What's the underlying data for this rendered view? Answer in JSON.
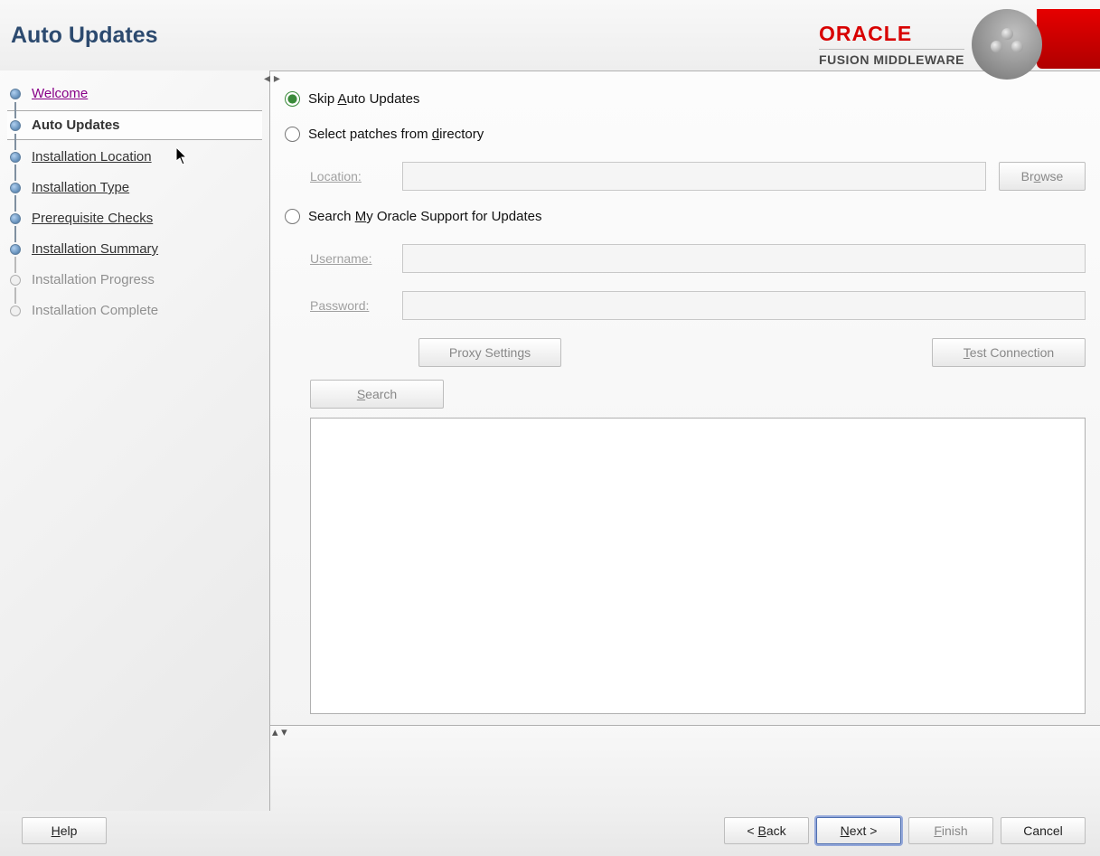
{
  "header": {
    "title": "Auto Updates",
    "brand_top": "ORACLE",
    "brand_bottom": "FUSION MIDDLEWARE"
  },
  "sidebar": {
    "steps": [
      {
        "label": "Welcome",
        "state": "visited"
      },
      {
        "label": "Auto Updates",
        "state": "current"
      },
      {
        "label": "Installation Location",
        "state": "link"
      },
      {
        "label": "Installation Type",
        "state": "link"
      },
      {
        "label": "Prerequisite Checks",
        "state": "link"
      },
      {
        "label": "Installation Summary",
        "state": "link"
      },
      {
        "label": "Installation Progress",
        "state": "disabled"
      },
      {
        "label": "Installation Complete",
        "state": "disabled"
      }
    ]
  },
  "main": {
    "radio_skip_pre": "Skip ",
    "radio_skip_u": "A",
    "radio_skip_post": "uto Updates",
    "radio_dir_pre": "Select patches from ",
    "radio_dir_u": "d",
    "radio_dir_post": "irectory",
    "radio_mos_pre": "Search ",
    "radio_mos_u": "M",
    "radio_mos_mid": "y",
    "radio_mos_post": " Oracle Support for Updates",
    "location_label": "Location:",
    "location_value": "",
    "browse_label": "Browse",
    "username_label": "Username:",
    "username_value": "",
    "password_label": "Password:",
    "password_value": "",
    "proxy_label": "Proxy Settings",
    "test_label_u": "T",
    "test_label_post": "est Connection",
    "search_label_u": "S",
    "search_label_post": "earch"
  },
  "footer": {
    "help_u": "H",
    "help_post": "elp",
    "back_pre": "< ",
    "back_u": "B",
    "back_post": "ack",
    "next_u": "N",
    "next_post": "ext >",
    "finish_u": "F",
    "finish_post": "inish",
    "cancel": "Cancel"
  }
}
